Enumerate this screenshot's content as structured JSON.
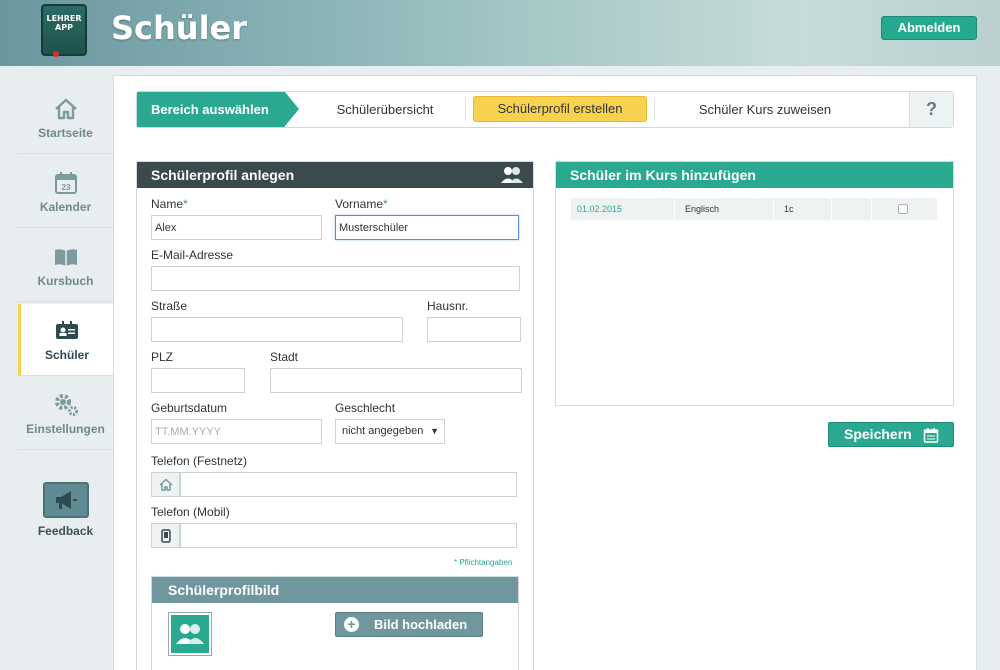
{
  "header": {
    "logo_text": "LEHRER APP",
    "title": "Schüler",
    "logout_label": "Abmelden"
  },
  "sidebar": {
    "items": [
      {
        "label": "Startseite",
        "icon": "home-icon"
      },
      {
        "label": "Kalender",
        "icon": "calendar-icon",
        "calendar_day": "23"
      },
      {
        "label": "Kursbuch",
        "icon": "book-icon"
      },
      {
        "label": "Schüler",
        "icon": "student-card-icon",
        "active": true
      },
      {
        "label": "Einstellungen",
        "icon": "gears-icon"
      }
    ],
    "feedback_label": "Feedback"
  },
  "wizard": {
    "first_label": "Bereich auswählen",
    "steps": [
      "Schülerübersicht",
      "Schülerprofil erstellen",
      "Schüler Kurs zuweisen"
    ],
    "active_step": "Schülerprofil erstellen",
    "help_label": "?"
  },
  "form": {
    "title": "Schülerprofil anlegen",
    "name_label": "Name",
    "name_value": "Alex",
    "vorname_label": "Vorname",
    "vorname_value": "Musterschüler",
    "required_mark": "*",
    "email_label": "E-Mail-Adresse",
    "email_value": "",
    "strasse_label": "Straße",
    "hausnr_label": "Hausnr.",
    "plz_label": "PLZ",
    "stadt_label": "Stadt",
    "geburtsdatum_label": "Geburtsdatum",
    "geburtsdatum_placeholder": "TT.MM.YYYY",
    "geschlecht_label": "Geschlecht",
    "geschlecht_value": "nicht angegeben",
    "telefon_fest_label": "Telefon (Festnetz)",
    "telefon_mobil_label": "Telefon (Mobil)",
    "required_note": "* Pflichtangaben",
    "profile_picture_title": "Schülerprofilbild",
    "upload_label": "Bild hochladen"
  },
  "course_panel": {
    "title": "Schüler im Kurs hinzufügen",
    "rows": [
      {
        "date": "01.02.2015",
        "subject": "Englisch",
        "class": "1c",
        "checked": false
      }
    ]
  },
  "save_label": "Speichern",
  "colors": {
    "accent": "#2aa890",
    "active_step": "#f6d24f",
    "dark_header": "#3a4a4d",
    "muted_header": "#6f979d"
  }
}
